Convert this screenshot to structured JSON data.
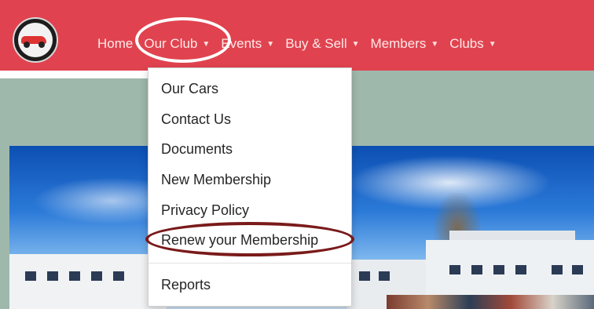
{
  "brand": {
    "logo_icon": "car-club-logo"
  },
  "nav": {
    "items": [
      {
        "label": "Home",
        "has_caret": false
      },
      {
        "label": "Our Club",
        "has_caret": true
      },
      {
        "label": "Events",
        "has_caret": true
      },
      {
        "label": "Buy & Sell",
        "has_caret": true
      },
      {
        "label": "Members",
        "has_caret": true
      },
      {
        "label": "Clubs",
        "has_caret": true
      }
    ],
    "caret_glyph": "▼",
    "bar_color": "#e0434f"
  },
  "dropdown": {
    "items": [
      {
        "label": "Our Cars"
      },
      {
        "label": "Contact Us"
      },
      {
        "label": "Documents"
      },
      {
        "label": "New Membership"
      },
      {
        "label": "Privacy Policy"
      },
      {
        "label": "Renew your Membership"
      },
      {
        "label": "Reports"
      }
    ]
  },
  "annotations": {
    "ourclub_circle_color": "#ffffff",
    "renew_circle_color": "#7a1a1a"
  }
}
